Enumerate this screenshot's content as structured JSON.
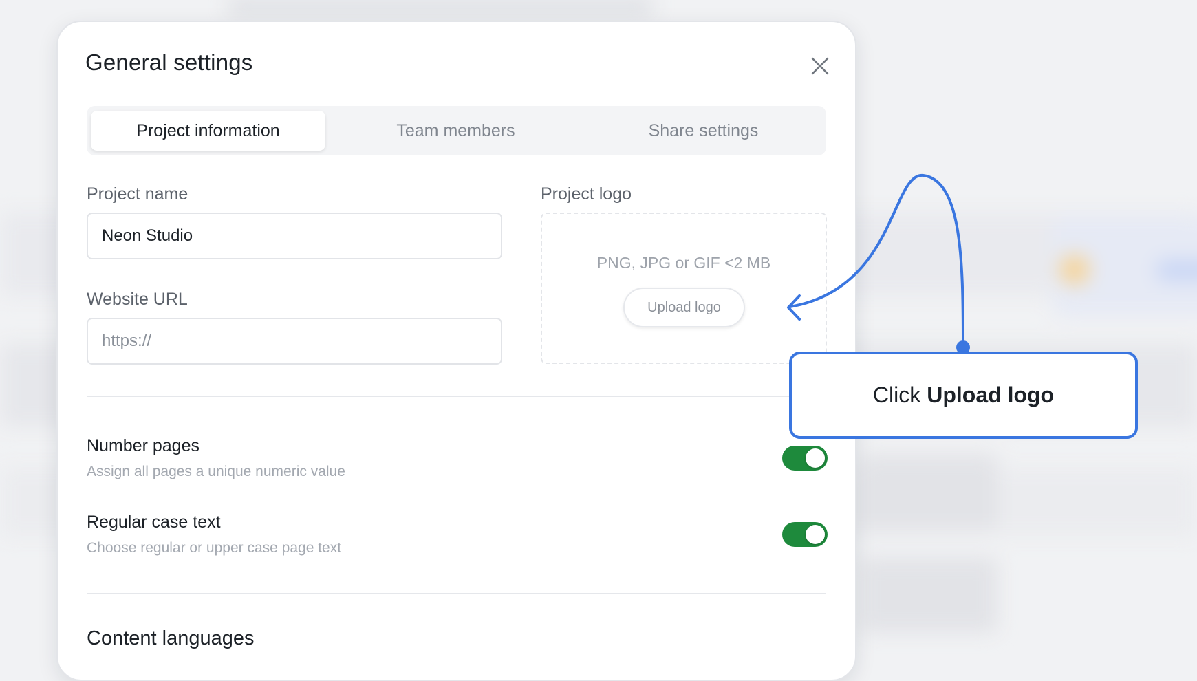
{
  "modal": {
    "title": "General settings",
    "close_icon": "close-icon"
  },
  "tabs": [
    {
      "label": "Project information",
      "active": true
    },
    {
      "label": "Team members",
      "active": false
    },
    {
      "label": "Share settings",
      "active": false
    }
  ],
  "project_name": {
    "label": "Project name",
    "value": "Neon Studio"
  },
  "website_url": {
    "label": "Website URL",
    "placeholder": "https://"
  },
  "project_logo": {
    "label": "Project logo",
    "hint": "PNG, JPG or GIF <2 MB",
    "button_label": "Upload logo"
  },
  "settings": [
    {
      "title": "Number pages",
      "description": "Assign all pages a unique numeric value",
      "enabled": true
    },
    {
      "title": "Regular case text",
      "description": "Choose regular or upper case page text",
      "enabled": true
    }
  ],
  "content_languages": {
    "heading": "Content languages"
  },
  "callout": {
    "prefix": "Click",
    "emphasis": "Upload logo"
  },
  "colors": {
    "accent": "#3a76e0",
    "toggle_on": "#1e8a3c"
  }
}
